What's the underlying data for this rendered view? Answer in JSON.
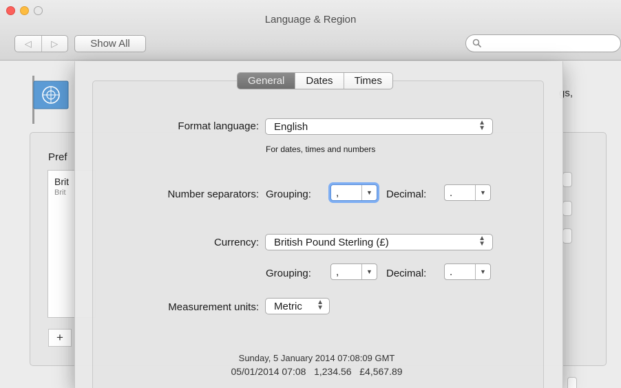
{
  "window": {
    "title": "Language & Region",
    "show_all_label": "Show All",
    "search": {
      "placeholder": ""
    }
  },
  "background": {
    "description_visible_tail": "gs,",
    "preferred_heading": "Pref",
    "preferred_item_name": "Brit",
    "preferred_item_sub": "Brit",
    "add_label": "+"
  },
  "sheet": {
    "tabs": [
      {
        "label": "General",
        "selected": true
      },
      {
        "label": "Dates",
        "selected": false
      },
      {
        "label": "Times",
        "selected": false
      }
    ],
    "format_language": {
      "label": "Format language:",
      "value": "English",
      "note": "For dates, times and numbers"
    },
    "number_separators": {
      "label": "Number separators:",
      "grouping_label": "Grouping:",
      "grouping_value": ",",
      "decimal_label": "Decimal:",
      "decimal_value": "."
    },
    "currency": {
      "label": "Currency:",
      "value": "British Pound Sterling (£)",
      "grouping_label": "Grouping:",
      "grouping_value": ",",
      "decimal_label": "Decimal:",
      "decimal_value": "."
    },
    "measurement": {
      "label": "Measurement units:",
      "value": "Metric"
    },
    "sample": {
      "line1": "Sunday, 5 January 2014 07:08:09 GMT",
      "line2": "05/01/2014 07:08   1,234.56   £4,567.89"
    }
  },
  "colors": {
    "accent_focus": "#7eaef3",
    "selected_tab": "#7c7c7c"
  }
}
